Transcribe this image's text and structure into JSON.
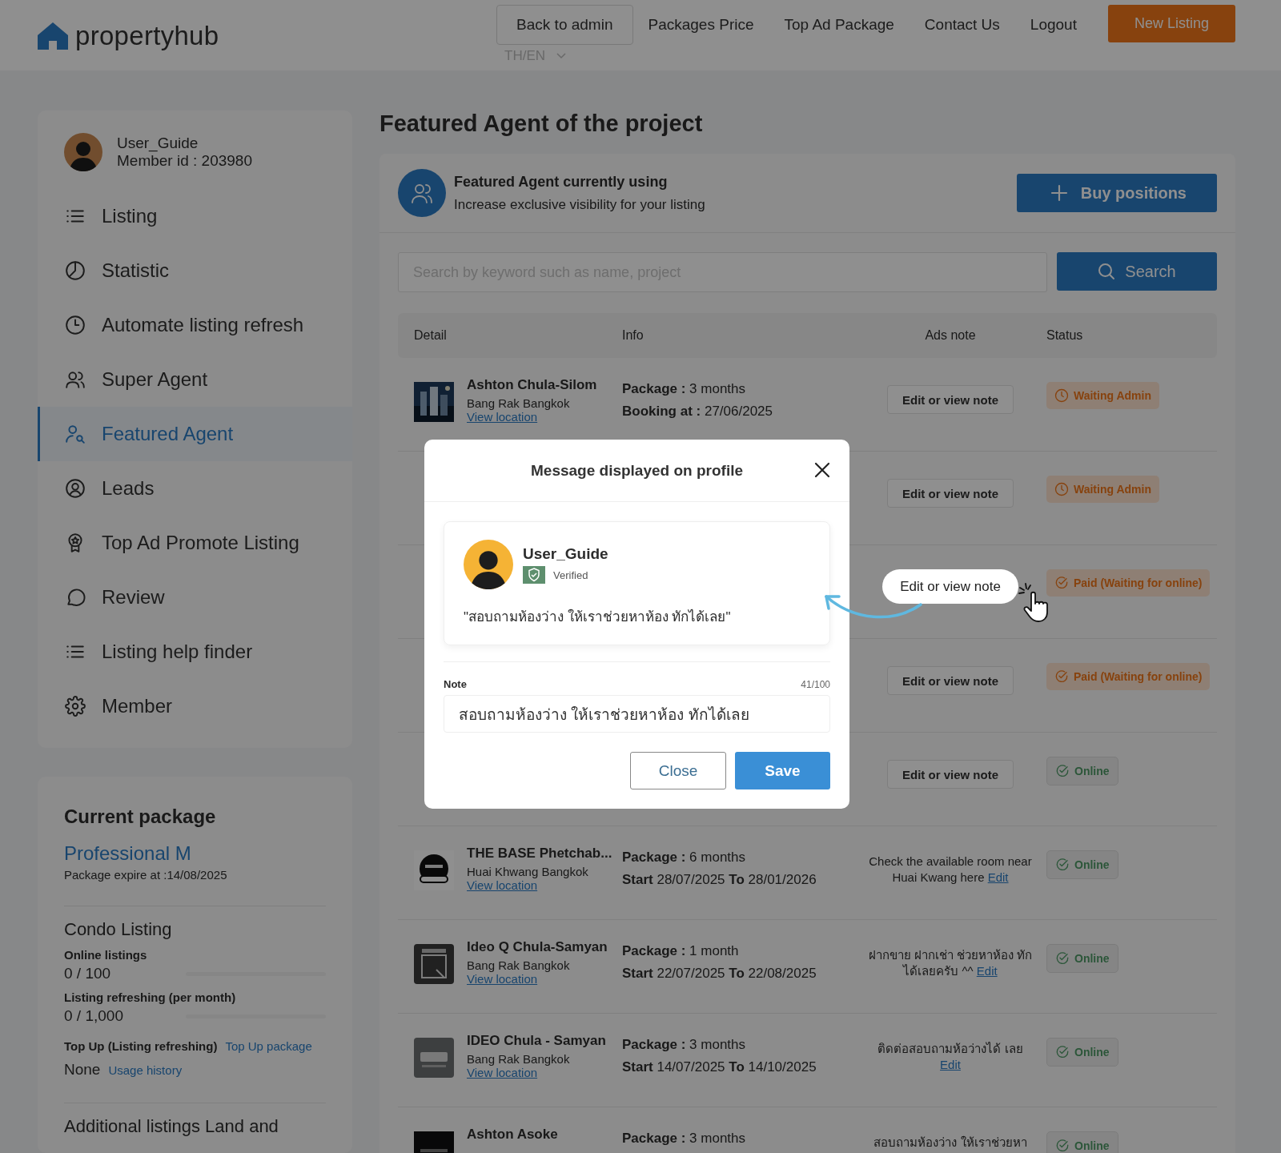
{
  "header": {
    "logo": "**property**hub",
    "nav": [
      {
        "label": "Back to admin",
        "kind": "boxed"
      },
      {
        "label": "Packages Price",
        "kind": "link"
      },
      {
        "label": "Top Ad Package",
        "kind": "link"
      },
      {
        "label": "Contact Us",
        "kind": "link"
      },
      {
        "label": "Logout",
        "kind": "link"
      },
      {
        "label": "New Listing",
        "kind": "primary"
      }
    ],
    "language": "TH/EN"
  },
  "sidebar": {
    "user": {
      "name": "User_Guide",
      "member_id": "Member id : 203980"
    },
    "items": [
      {
        "label": "Listing",
        "selected": false
      },
      {
        "label": "Statistic",
        "selected": false
      },
      {
        "label": "Automate listing refresh",
        "selected": false
      },
      {
        "label": "Super Agent",
        "selected": false
      },
      {
        "label": "Featured Agent",
        "selected": true
      },
      {
        "label": "Leads",
        "selected": false
      },
      {
        "label": "Top Ad Promote Listing",
        "selected": false
      },
      {
        "label": "Review",
        "selected": false
      },
      {
        "label": "Listing help finder",
        "selected": false
      },
      {
        "label": "Member",
        "selected": false
      }
    ]
  },
  "package": {
    "title": "Current package",
    "name": "Professional M",
    "expire": "Package expire at :14/08/2025",
    "section": "Condo Listing",
    "meters": [
      {
        "label": "Online listings",
        "reading": "0 / 100",
        "level": 0
      },
      {
        "label": "Listing refreshing (per month)",
        "reading": "0 / 1,000",
        "level": 0
      }
    ],
    "topup": {
      "label": "Top Up (Listing refreshing)",
      "link": "Top Up package",
      "value": "None",
      "history": "Usage history"
    },
    "next_section": "Additional listings Land and"
  },
  "main": {
    "title": "Featured Agent of the project",
    "banner": {
      "title": "Featured Agent currently using",
      "subtitle": "Increase exclusive visibility for your listing",
      "button": "Buy positions"
    },
    "search": {
      "placeholder": "Search by keyword such as name, project",
      "button": "Search"
    },
    "table": {
      "columns": [
        "Detail",
        "Info",
        "Ads note",
        "Status"
      ],
      "rows": [
        {
          "detail": {
            "name": "Ashton Chula-Silom",
            "location": "Bang Rak Bangkok",
            "link": "View location"
          },
          "info": [
            "**Package :** 3 months",
            "**Booking at :** 27/06/2025"
          ],
          "note": {
            "kind": "button",
            "text": "Edit or view note",
            "highlighted": false
          },
          "status": {
            "kind": "waiting",
            "text": "Waiting Admin"
          }
        },
        {
          "note": {
            "kind": "button",
            "text": "Edit or view note",
            "highlighted": false
          },
          "status": {
            "kind": "waiting",
            "text": "Waiting Admin"
          }
        },
        {
          "note": {
            "kind": "button",
            "text": "Edit or view note",
            "highlighted": true
          },
          "status": {
            "kind": "paid",
            "text": "Paid (Waiting for online)"
          }
        },
        {
          "note": {
            "kind": "button",
            "text": "Edit or view note",
            "highlighted": false
          },
          "status": {
            "kind": "paid",
            "text": "Paid (Waiting for online)"
          }
        },
        {
          "note": {
            "kind": "button",
            "text": "Edit or view note",
            "highlighted": false
          },
          "status": {
            "kind": "online",
            "text": "Online"
          }
        },
        {
          "detail": {
            "name": "THE BASE Phetchab...",
            "location": "Huai Khwang Bangkok",
            "link": "View location"
          },
          "info": [
            "**Package :** 6 months",
            "**Start** 28/07/2025 **To** 28/01/2026"
          ],
          "note": {
            "kind": "text",
            "text": "Check the available room near Huai Kwang here",
            "link": "Edit"
          },
          "status": {
            "kind": "online",
            "text": "Online"
          }
        },
        {
          "detail": {
            "name": "Ideo Q Chula-Samyan",
            "location": "Bang Rak Bangkok",
            "link": "View location"
          },
          "info": [
            "**Package :** 1 month",
            "**Start** 22/07/2025 **To** 22/08/2025"
          ],
          "note": {
            "kind": "text",
            "text": "ฝากขาย ฝากเช่า ช่วยหาห้อง ทักได้เลยครับ ^^",
            "link": "Edit"
          },
          "status": {
            "kind": "online",
            "text": "Online"
          }
        },
        {
          "detail": {
            "name": "IDEO Chula - Samyan",
            "location": "Bang Rak Bangkok",
            "link": "View location"
          },
          "info": [
            "**Package :** 3 months",
            "**Start** 14/07/2025 **To** 14/10/2025"
          ],
          "note": {
            "kind": "text",
            "text": "ติดต่อสอบถามห้อว่างได้ เลย",
            "link": "Edit"
          },
          "status": {
            "kind": "online",
            "text": "Online"
          }
        },
        {
          "detail": {
            "name": "Ashton Asoke"
          },
          "info": [
            "**Package :** 3 months"
          ],
          "note": {
            "kind": "text",
            "text": "สอบถามห้องว่าง ให้เราช่วยหา"
          },
          "status": {
            "kind": "online",
            "text": "Online"
          }
        }
      ]
    }
  },
  "modal": {
    "title": "Message displayed on profile",
    "preview": {
      "name": "User_Guide",
      "badge": "Verified",
      "message": "\"สอบถามห้องว่าง ให้เราช่วยหาห้อง ทักได้เลย\""
    },
    "note_label": "Note",
    "counter": "41/100",
    "note_value": "สอบถามห้องว่าง ให้เราช่วยหาห้อง ทักได้เลย",
    "buttons": [
      {
        "label": "Close",
        "kind": "secondary"
      },
      {
        "label": "Save",
        "kind": "primary"
      }
    ]
  }
}
